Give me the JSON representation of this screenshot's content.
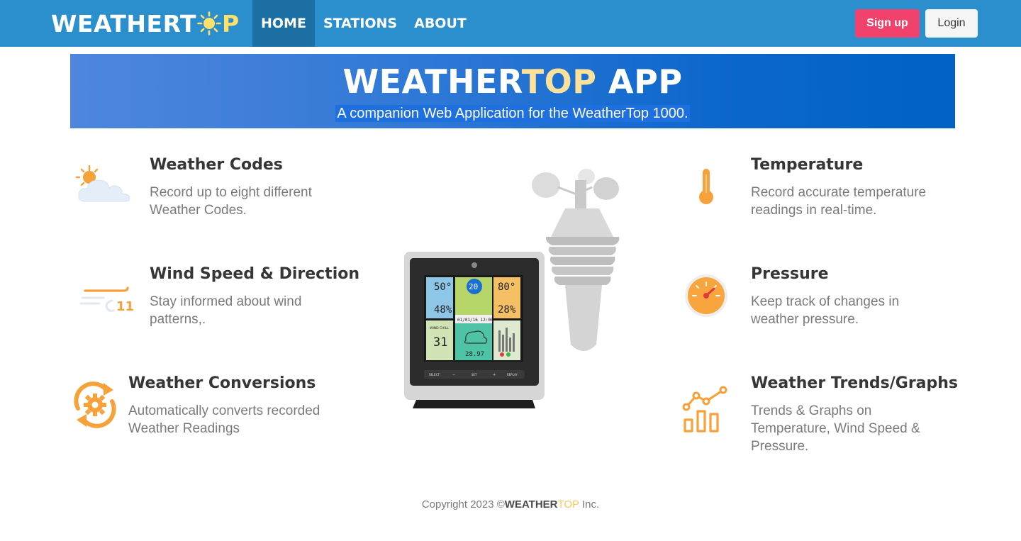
{
  "navbar": {
    "brand": {
      "part1": "WEATHERT",
      "part2": "P"
    },
    "links": [
      {
        "label": "HOME",
        "active": true
      },
      {
        "label": "STATIONS",
        "active": false
      },
      {
        "label": "ABOUT",
        "active": false
      }
    ],
    "signup_label": "Sign up",
    "login_label": "Login"
  },
  "hero": {
    "title_part1": "WEATHER",
    "title_part2": "TOP",
    "title_part3": " APP",
    "subtitle": "A companion Web Application for the WeatherTop 1000."
  },
  "features_left": [
    {
      "title": "Weather Codes",
      "desc": "Record up to eight different Weather Codes.",
      "icon": "sun-cloud-icon"
    },
    {
      "title": "Wind Speed & Direction",
      "desc": "Stay informed about wind patterns,.",
      "icon": "wind-icon"
    },
    {
      "title": "Weather Conversions",
      "desc": "Automatically converts recorded Weather Readings",
      "icon": "conversion-gear-icon"
    }
  ],
  "features_right": [
    {
      "title": "Temperature",
      "desc": "Record accurate temperature readings in real-time.",
      "icon": "thermometer-icon"
    },
    {
      "title": "Pressure",
      "desc": "Keep track of changes in weather pressure.",
      "icon": "pressure-gauge-icon"
    },
    {
      "title": "Weather Trends/Graphs",
      "desc": "Trends & Graphs on Temperature, Wind Speed & Pressure.",
      "icon": "trend-graph-icon"
    }
  ],
  "station_display": {
    "outdoor_temp": "50°",
    "outdoor_humidity": "48%",
    "indoor_temp": "80°",
    "indoor_humidity": "28%",
    "wind_speed": "20",
    "wind_chill": "31",
    "date_time": "01/01/16  12:00",
    "pressure": "28.97",
    "wind_label": "WIND CHILL",
    "buttons": [
      "SELECT",
      "−",
      "SET",
      "+",
      "REPLAY"
    ]
  },
  "wind_icon_number": "11",
  "footer": {
    "prefix": "Copyright 2023 ©",
    "brand1": "WEATHER",
    "brand2": "TOP",
    "suffix": " Inc."
  },
  "colors": {
    "navbar": "#2b8fce",
    "nav_active": "#1b6fa3",
    "signup": "#f0426d",
    "accent_yellow": "#f6c85f",
    "icon_orange": "#f7a13a"
  }
}
